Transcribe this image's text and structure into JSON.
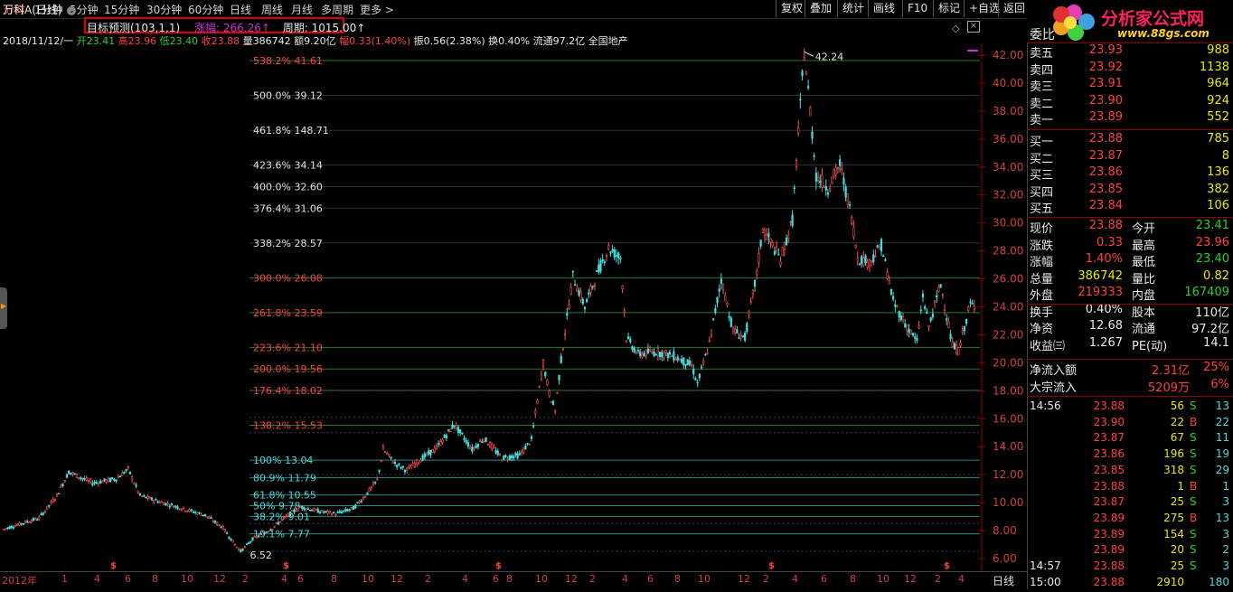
{
  "period_tabs": [
    "分时",
    "1分钟",
    "5分钟",
    "15分钟",
    "30分钟",
    "60分钟",
    "日线",
    "周线",
    "月线",
    "多周期",
    "更多 >"
  ],
  "active_period": 6,
  "toolbar": [
    "复权",
    "叠加",
    "统计",
    "画线",
    "F10",
    "标记",
    "+自选",
    "返回"
  ],
  "stock": {
    "name": "万科A(日线)",
    "predict_label": "目标预测(103,1,1)",
    "gain_label": "涨幅:",
    "gain_value": "266.26↑",
    "period_label": "周期:",
    "period_value": "1015.00↑",
    "info_date": "2018/11/12/一",
    "info_open": "开23.41",
    "info_high": "高23.96",
    "info_low": "低23.40",
    "info_close": "收23.88",
    "info_vol": "量386742",
    "info_amt": "额9.20亿",
    "info_pct": "幅0.33(1.40%)",
    "info_rest": "振0.56(2.38%) 换0.40% 流通97.2亿 全国地产"
  },
  "fib_levels": [
    {
      "pct": "538.2%",
      "price": "41.61",
      "value": 41.61,
      "color": "#ff4040"
    },
    {
      "pct": "500.0%",
      "price": "39.12",
      "value": 39.12,
      "color": "#e0e0e0"
    },
    {
      "pct": "461.8%",
      "price": "148.71",
      "value": 36.62,
      "color": "#e0e0e0"
    },
    {
      "pct": "423.6%",
      "price": "34.14",
      "value": 34.14,
      "color": "#e0e0e0"
    },
    {
      "pct": "400.0%",
      "price": "32.60",
      "value": 32.6,
      "color": "#e0e0e0"
    },
    {
      "pct": "376.4%",
      "price": "31.06",
      "value": 31.06,
      "color": "#e0e0e0"
    },
    {
      "pct": "338.2%",
      "price": "28.57",
      "value": 28.57,
      "color": "#e0e0e0"
    },
    {
      "pct": "300.0%",
      "price": "26.08",
      "value": 26.08,
      "color": "#ff4040"
    },
    {
      "pct": "261.8%",
      "price": "23.59",
      "value": 23.59,
      "color": "#ff4040"
    },
    {
      "pct": "223.6%",
      "price": "21.10",
      "value": 21.1,
      "color": "#ff4040"
    },
    {
      "pct": "200.0%",
      "price": "19.56",
      "value": 19.56,
      "color": "#ff4040"
    },
    {
      "pct": "176.4%",
      "price": "18.02",
      "value": 18.02,
      "color": "#ff4040"
    },
    {
      "pct": "138.2%",
      "price": "15.53",
      "value": 15.53,
      "color": "#ff4040"
    },
    {
      "pct": "100%",
      "price": "13.04",
      "value": 13.04,
      "color": "#4fd8d8"
    },
    {
      "pct": "80.9%",
      "price": "11.79",
      "value": 11.79,
      "color": "#4fd8d8"
    },
    {
      "pct": "61.8%",
      "price": "10.55",
      "value": 10.55,
      "color": "#4fd8d8"
    },
    {
      "pct": "50%",
      "price": "9.78",
      "value": 9.78,
      "color": "#4fd8d8"
    },
    {
      "pct": "38.2%",
      "price": "9.01",
      "value": 9.01,
      "color": "#4fd8d8"
    },
    {
      "pct": "19.1%",
      "price": "7.77",
      "value": 7.77,
      "color": "#4fd8d8"
    }
  ],
  "chart_data": {
    "type": "candlestick",
    "y_ticks": [
      "42.00",
      "40.00",
      "38.00",
      "36.00",
      "34.00",
      "32.00",
      "30.00",
      "28.00",
      "26.00",
      "24.00",
      "22.00",
      "20.00",
      "18.00",
      "16.00",
      "14.00",
      "12.00",
      "10.00",
      "8.00",
      "6.00"
    ],
    "ylim": [
      5.3,
      43.2
    ],
    "x_ticks": [
      "2012年",
      "1",
      "4",
      "6",
      "8",
      "10",
      "12",
      "2",
      "4",
      "6",
      "8",
      "10",
      "12",
      "2",
      "4",
      "6",
      "8",
      "10",
      "12",
      "2",
      "4",
      "6",
      "8",
      "10",
      "12",
      "2",
      "4",
      "6",
      "8",
      "10",
      "12",
      "2",
      "4",
      "6",
      "8",
      "10"
    ],
    "max_label": "42.24",
    "min_label": "6.52",
    "bottom_right": "日线",
    "price_path": [
      [
        0,
        8.1
      ],
      [
        3,
        8.5
      ],
      [
        6,
        8.9
      ],
      [
        9,
        10.5
      ],
      [
        11,
        12.2
      ],
      [
        15,
        11.4
      ],
      [
        19,
        11.7
      ],
      [
        21,
        12.4
      ],
      [
        23,
        10.5
      ],
      [
        26,
        10.1
      ],
      [
        30,
        9.6
      ],
      [
        34,
        9.1
      ],
      [
        37,
        8.2
      ],
      [
        39,
        7.0
      ],
      [
        40,
        6.52
      ],
      [
        42,
        7.4
      ],
      [
        45,
        8.1
      ],
      [
        48,
        9.1
      ],
      [
        50,
        9.7
      ],
      [
        53,
        9.4
      ],
      [
        56,
        9.2
      ],
      [
        59,
        9.6
      ],
      [
        61,
        10.5
      ],
      [
        63,
        11.6
      ],
      [
        64,
        13.8
      ],
      [
        66,
        12.8
      ],
      [
        68,
        12.3
      ],
      [
        70,
        13.0
      ],
      [
        73,
        13.9
      ],
      [
        76,
        15.6
      ],
      [
        79,
        13.8
      ],
      [
        81,
        14.6
      ],
      [
        84,
        13.2
      ],
      [
        87,
        13.4
      ],
      [
        89,
        14.5
      ],
      [
        91,
        20.0
      ],
      [
        92,
        17.8
      ],
      [
        93,
        16.6
      ],
      [
        94,
        20.2
      ],
      [
        96,
        26.2
      ],
      [
        98,
        24.0
      ],
      [
        100,
        26.3
      ],
      [
        102,
        28.2
      ],
      [
        104,
        27.5
      ],
      [
        105,
        21.8
      ],
      [
        107,
        20.6
      ],
      [
        110,
        20.8
      ],
      [
        113,
        20.5
      ],
      [
        116,
        19.8
      ],
      [
        117,
        18.5
      ],
      [
        119,
        21.4
      ],
      [
        121,
        26.0
      ],
      [
        123,
        22.3
      ],
      [
        125,
        21.8
      ],
      [
        127,
        26.4
      ],
      [
        128,
        29.6
      ],
      [
        131,
        27.4
      ],
      [
        133,
        30.2
      ],
      [
        134,
        36.4
      ],
      [
        135,
        42.24
      ],
      [
        136,
        38.0
      ],
      [
        137,
        33.4
      ],
      [
        139,
        32.5
      ],
      [
        141,
        34.2
      ],
      [
        143,
        30.4
      ],
      [
        144,
        27.5
      ],
      [
        146,
        27.2
      ],
      [
        148,
        28.4
      ],
      [
        150,
        24.4
      ],
      [
        152,
        22.8
      ],
      [
        154,
        21.5
      ],
      [
        155,
        24.8
      ],
      [
        156,
        22.6
      ],
      [
        158,
        25.6
      ],
      [
        160,
        21.2
      ],
      [
        161,
        20.9
      ],
      [
        163,
        24.2
      ],
      [
        164,
        23.88
      ]
    ]
  },
  "quote": {
    "header": "委比",
    "sell": [
      [
        "卖五",
        "23.93",
        "988"
      ],
      [
        "卖四",
        "23.92",
        "1138"
      ],
      [
        "卖三",
        "23.91",
        "964"
      ],
      [
        "卖二",
        "23.90",
        "924"
      ],
      [
        "卖一",
        "23.89",
        "552"
      ]
    ],
    "buy": [
      [
        "买一",
        "23.88",
        "785"
      ],
      [
        "买二",
        "23.87",
        "8"
      ],
      [
        "买三",
        "23.86",
        "136"
      ],
      [
        "买四",
        "23.85",
        "382"
      ],
      [
        "买五",
        "23.84",
        "106"
      ]
    ],
    "stats": [
      [
        "现价",
        "23.88",
        "今开",
        "23.41"
      ],
      [
        "涨跌",
        "0.33",
        "最高",
        "23.96"
      ],
      [
        "涨幅",
        "1.40%",
        "最低",
        "23.40"
      ],
      [
        "总量",
        "386742",
        "量比",
        "0.82"
      ],
      [
        "外盘",
        "219333",
        "内盘",
        "167409"
      ],
      [
        "换手",
        "0.40%",
        "股本",
        "110亿"
      ],
      [
        "净资",
        "12.68",
        "流通",
        "97.2亿"
      ],
      [
        "收益㈢",
        "1.267",
        "PE(动)",
        "14.1"
      ]
    ],
    "flow": [
      [
        "净流入额",
        "2.31亿",
        "25%"
      ],
      [
        "大宗流入",
        "5209万",
        "6%"
      ]
    ],
    "ticks": [
      [
        "14:56",
        "23.88",
        "56",
        "S",
        "13"
      ],
      [
        "",
        "23.90",
        "22",
        "B",
        "22"
      ],
      [
        "",
        "23.87",
        "67",
        "S",
        "11"
      ],
      [
        "",
        "23.86",
        "196",
        "S",
        "19"
      ],
      [
        "",
        "23.85",
        "318",
        "S",
        "29"
      ],
      [
        "",
        "23.88",
        "1",
        "B",
        "1"
      ],
      [
        "",
        "23.87",
        "25",
        "S",
        "3"
      ],
      [
        "",
        "23.89",
        "275",
        "B",
        "13"
      ],
      [
        "",
        "23.89",
        "154",
        "S",
        "3"
      ],
      [
        "",
        "23.89",
        "20",
        "S",
        "2"
      ],
      [
        "14:57",
        "23.88",
        "25",
        "S",
        "3"
      ],
      [
        "15:00",
        "23.88",
        "2910",
        "",
        "180"
      ]
    ]
  },
  "logo": {
    "title": "分析家公式网",
    "url": "www.88gs.com"
  }
}
